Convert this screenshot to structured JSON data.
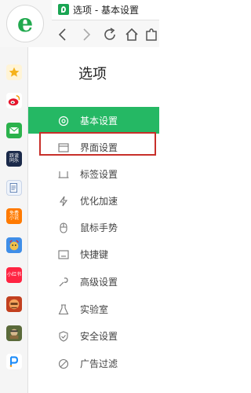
{
  "browser": {
    "tab_title": "选项 - 基本设置"
  },
  "panel": {
    "title": "选项",
    "menu": [
      {
        "label": "基本设置",
        "icon": "gear-icon",
        "active": true
      },
      {
        "label": "界面设置",
        "icon": "window-icon",
        "active": false
      },
      {
        "label": "标签设置",
        "icon": "tab-icon",
        "active": false
      },
      {
        "label": "优化加速",
        "icon": "lightning-icon",
        "active": false
      },
      {
        "label": "鼠标手势",
        "icon": "mouse-icon",
        "active": false
      },
      {
        "label": "快捷键",
        "icon": "keyboard-icon",
        "active": false
      },
      {
        "label": "高级设置",
        "icon": "wrench-icon",
        "active": false
      },
      {
        "label": "实验室",
        "icon": "flask-icon",
        "active": false
      },
      {
        "label": "安全设置",
        "icon": "shield-icon",
        "active": false
      },
      {
        "label": "广告过滤",
        "icon": "block-icon",
        "active": false
      }
    ]
  },
  "sidebar_apps": [
    {
      "name": "favorites",
      "icon": "star-icon"
    },
    {
      "name": "weibo",
      "icon": "weibo-icon"
    },
    {
      "name": "mail",
      "icon": "mail-icon"
    },
    {
      "name": "tantan",
      "icon": "tantan-icon",
      "text": "跃读\n同乐"
    },
    {
      "name": "word",
      "icon": "doc-icon"
    },
    {
      "name": "free-novel",
      "icon": "novel-icon",
      "text": "免费\n小说"
    },
    {
      "name": "game1",
      "icon": "game-icon"
    },
    {
      "name": "xiaohongshu",
      "icon": "xhs-icon",
      "text": "小红书"
    },
    {
      "name": "game2",
      "icon": "game-icon"
    },
    {
      "name": "game3",
      "icon": "game-icon"
    },
    {
      "name": "p-app",
      "icon": "p-icon"
    }
  ],
  "colors": {
    "accent": "#25b864",
    "highlight": "#c8302a"
  }
}
